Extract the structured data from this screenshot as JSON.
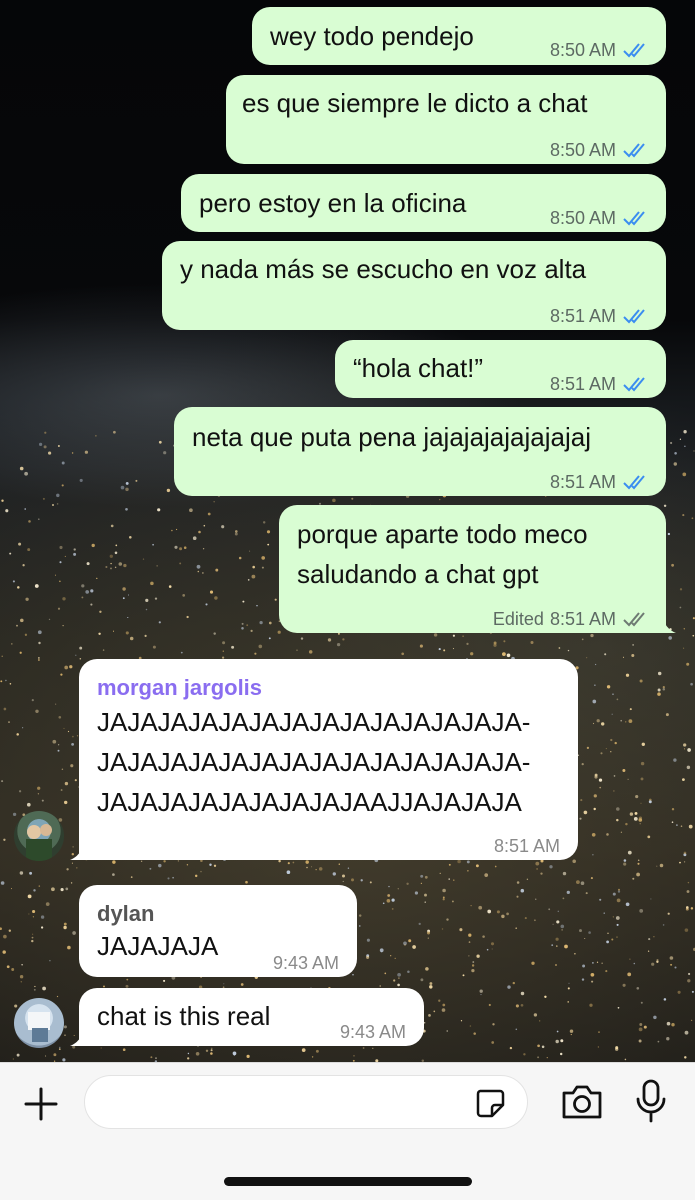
{
  "chat": {
    "messages": [
      {
        "direction": "outgoing",
        "lines": [
          "wey todo pendejo"
        ],
        "time": "8:50 AM",
        "status": "read"
      },
      {
        "direction": "outgoing",
        "lines": [
          "es que siempre le dicto a chat"
        ],
        "time": "8:50 AM",
        "status": "read"
      },
      {
        "direction": "outgoing",
        "lines": [
          "pero estoy en la oficina"
        ],
        "time": "8:50 AM",
        "status": "read"
      },
      {
        "direction": "outgoing",
        "lines": [
          "y nada más se escucho en voz alta"
        ],
        "time": "8:51 AM",
        "status": "read"
      },
      {
        "direction": "outgoing",
        "lines": [
          "“hola chat!”"
        ],
        "time": "8:51 AM",
        "status": "read"
      },
      {
        "direction": "outgoing",
        "lines": [
          "neta que puta pena jajajajajajajajaj"
        ],
        "time": "8:51 AM",
        "status": "read"
      },
      {
        "direction": "outgoing",
        "lines": [
          "porque aparte todo meco",
          "saludando a chat gpt"
        ],
        "edited": "Edited",
        "time": "8:51 AM",
        "status": "delivered"
      },
      {
        "direction": "incoming",
        "sender": "morgan jargolis",
        "lines": [
          "JAJAJAJAJAJAJAJAJAJAJAJAJAJA-",
          "JAJAJAJAJAJAJAJAJAJAJAJAJAJA-",
          "JAJAJAJAJAJAJAJAJAAJJAJAJAJA"
        ],
        "time": "8:51 AM"
      },
      {
        "direction": "incoming",
        "sender": "dylan",
        "lines": [
          "JAJAJAJA"
        ],
        "time": "9:43 AM"
      },
      {
        "direction": "incoming",
        "lines": [
          "chat is this real"
        ],
        "time": "9:43 AM"
      }
    ]
  },
  "colors": {
    "outgoing_bubble": "#d9fdd3",
    "incoming_bubble": "#ffffff",
    "read_ticks": "#3b8df0",
    "delivered_ticks": "#6e7a73",
    "sender_morgan": "#8a6df0",
    "sender_dylan": "#555555"
  },
  "composer": {
    "input_value": "",
    "icons": [
      "plus-icon",
      "sticker-icon",
      "camera-icon",
      "microphone-icon"
    ]
  }
}
